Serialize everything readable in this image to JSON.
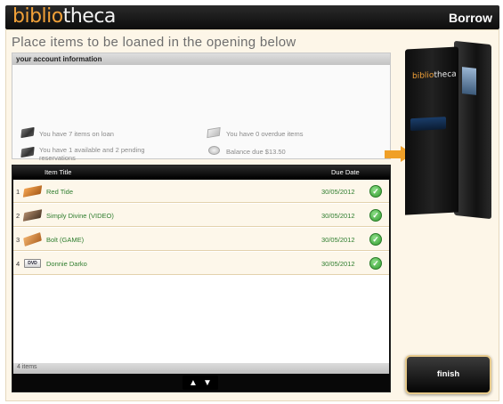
{
  "header": {
    "brand_part1": "biblio",
    "brand_part2": "theca",
    "mode": "Borrow"
  },
  "instructions": "Place items to be loaned in the opening below",
  "account": {
    "heading": "your account information",
    "items_on_loan": "You have 7 items on loan",
    "reservations": "You have 1 available and 2 pending reservations",
    "overdue": "You have 0 overdue items",
    "balance": "Balance due $13.50"
  },
  "table": {
    "columns": {
      "title": "Item Title",
      "due": "Due Date"
    },
    "rows": [
      {
        "num": "1",
        "title": "Red Tide",
        "due": "30/05/2012",
        "icon": "book-icon"
      },
      {
        "num": "2",
        "title": "Simply Divine (VIDEO)",
        "due": "30/05/2012",
        "icon": "video-icon"
      },
      {
        "num": "3",
        "title": "Bolt (GAME)",
        "due": "30/05/2012",
        "icon": "game-icon"
      },
      {
        "num": "4",
        "title": "Donnie Darko",
        "due": "30/05/2012",
        "icon": "dvd-icon"
      }
    ],
    "count": "4 items",
    "dvd_label": "DVD"
  },
  "kiosk": {
    "logo_part1": "biblio",
    "logo_part2": "theca"
  },
  "finish_label": "finish",
  "colors": {
    "brand_orange": "#f0a038",
    "item_green": "#2e7d2e",
    "panel_bg": "#fdf6e8"
  }
}
